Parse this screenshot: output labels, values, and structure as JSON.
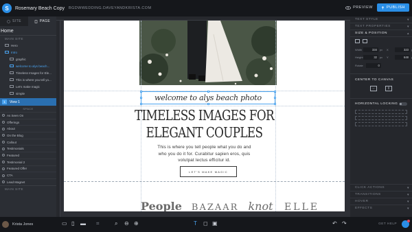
{
  "app": {
    "site_title": "Rosemary Beach Copy",
    "site_url": "BGDWWEDDING.DAVEYANDKRISTA.COM",
    "preview_label": "PREVIEW",
    "publish_label": "PUBLISH",
    "accent_color": "#2a8ee6"
  },
  "left_panel": {
    "tabs": [
      {
        "label": "SITE",
        "icon": "globe-icon"
      },
      {
        "label": "PAGE",
        "icon": "page-icon"
      }
    ],
    "page_name": "Home",
    "main_site_label": "MAIN SITE",
    "layers": [
      {
        "label": "Hero",
        "selected": false,
        "indent": 1
      },
      {
        "label": "Intro",
        "selected": true,
        "indent": 1
      },
      {
        "label": "graphic",
        "selected": false,
        "indent": 2
      },
      {
        "label": "welcome to alys beach...",
        "selected": true,
        "indent": 2
      },
      {
        "label": "Timeless Images for Ele...",
        "selected": false,
        "indent": 2
      },
      {
        "label": "This is where you tell yo...",
        "selected": false,
        "indent": 2
      },
      {
        "label": "Let's make magic",
        "selected": false,
        "indent": 2
      },
      {
        "label": "simple",
        "selected": false,
        "indent": 2
      }
    ],
    "view_row": {
      "number": "1",
      "label": "View 1"
    },
    "divider_label": "SPACE",
    "sections": [
      "As Seen On",
      "Offerings",
      "About",
      "On the Blog",
      "Callout",
      "Testimonials",
      "Featured",
      "Testimonial 2",
      "Featured Offer",
      "CTA",
      "Lead Magnet"
    ],
    "footer_label": "MAIN SITE"
  },
  "canvas": {
    "script_heading": "welcome to alys beach photo",
    "headline_line1": "TIMELESS IMAGES FOR",
    "headline_line2": "ELEGANT COUPLES",
    "body_text": "This is where you tell people what you do and who you do it for. Curabitur sapien eros, quis volutpat lectus efficitur id.",
    "cta_label": "LET'S MAKE MAGIC",
    "press_logos": [
      "People",
      "BAZAAR",
      "the knot",
      "ELLE"
    ]
  },
  "right_panel": {
    "text_style_label": "TEXT STYLE",
    "text_properties_label": "TEXT PROPERTIES",
    "size_position_label": "SIZE & POSITION",
    "fields": {
      "width_label": "Width",
      "width_value": "334",
      "width_unit": "px",
      "x_label": "X",
      "x_value": "323",
      "x_unit": "px",
      "height_label": "Height",
      "height_value": "32",
      "height_unit": "px",
      "y_label": "Y",
      "y_value": "648",
      "y_unit": "px",
      "rotate_label": "Rotate",
      "rotate_value": "0"
    },
    "center_label": "CENTER TO CANVAS",
    "horizontal_locking_label": "HORIZONTAL LOCKING",
    "bottom_sections": [
      "CLICK ACTIONS",
      "TRANSITIONS",
      "HOVER",
      "EFFECTS"
    ]
  },
  "bottom_bar": {
    "user_name": "Krista Jones",
    "help_label": "GET HELP"
  }
}
